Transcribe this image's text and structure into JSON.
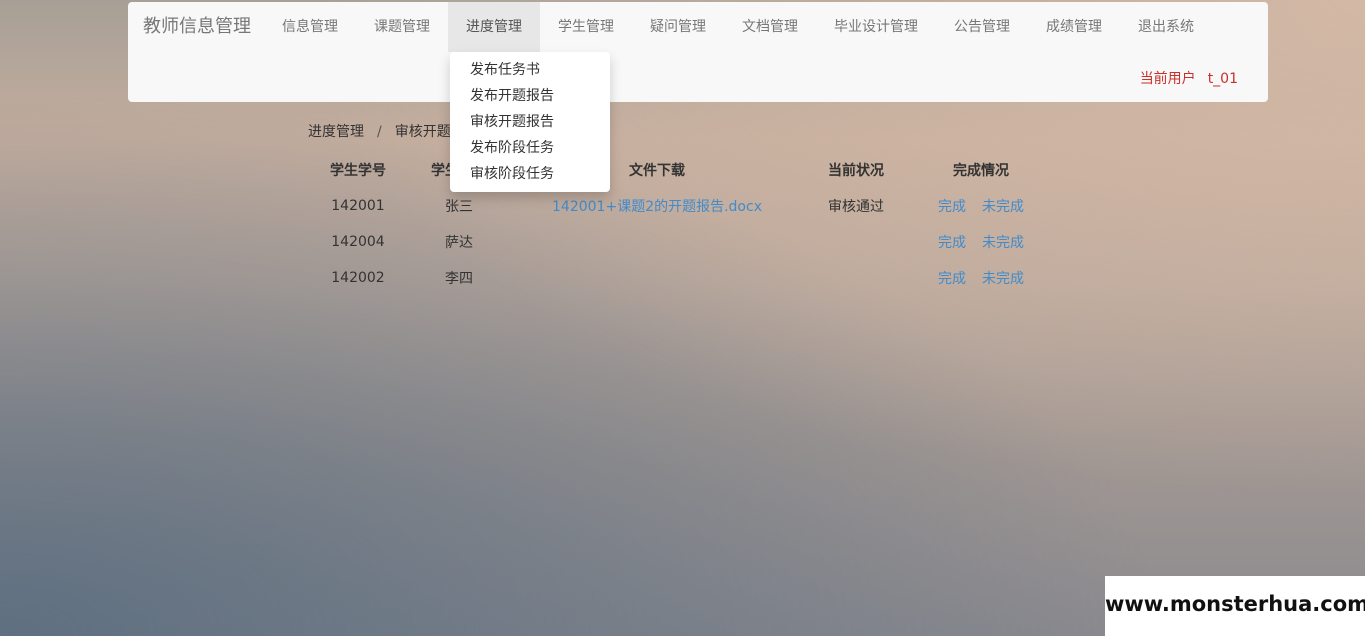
{
  "header": {
    "brand": "教师信息管理",
    "nav_items": [
      {
        "label": "信息管理"
      },
      {
        "label": "课题管理"
      },
      {
        "label": "进度管理",
        "active": true
      },
      {
        "label": "学生管理"
      },
      {
        "label": "疑问管理"
      },
      {
        "label": "文档管理"
      },
      {
        "label": "毕业设计管理"
      },
      {
        "label": "公告管理"
      },
      {
        "label": "成绩管理"
      },
      {
        "label": "退出系统"
      }
    ],
    "current_user_label": "当前用户",
    "current_user_name": "t_01"
  },
  "dropdown": {
    "items": [
      "发布任务书",
      "发布开题报告",
      "审核开题报告",
      "发布阶段任务",
      "审核阶段任务"
    ]
  },
  "breadcrumb": {
    "parent": "进度管理",
    "divider": "/",
    "current": "审核开题"
  },
  "table": {
    "headers": [
      "学生学号",
      "学生姓名",
      "文件下载",
      "当前状况",
      "完成情况"
    ],
    "rows": [
      {
        "id": "142001",
        "name": "张三",
        "file": "142001+课题2的开题报告.docx",
        "status": "审核通过",
        "done": "完成",
        "undone": "未完成"
      },
      {
        "id": "142004",
        "name": "萨达",
        "file": "",
        "status": "",
        "done": "完成",
        "undone": "未完成"
      },
      {
        "id": "142002",
        "name": "李四",
        "file": "",
        "status": "",
        "done": "完成",
        "undone": "未完成"
      }
    ]
  },
  "watermark": "www.monsterhua.com",
  "colors": {
    "link": "#428bca",
    "user": "#c9302c",
    "navbar_bg": "#f8f8f8",
    "nav_active_bg": "#e7e7e7"
  }
}
